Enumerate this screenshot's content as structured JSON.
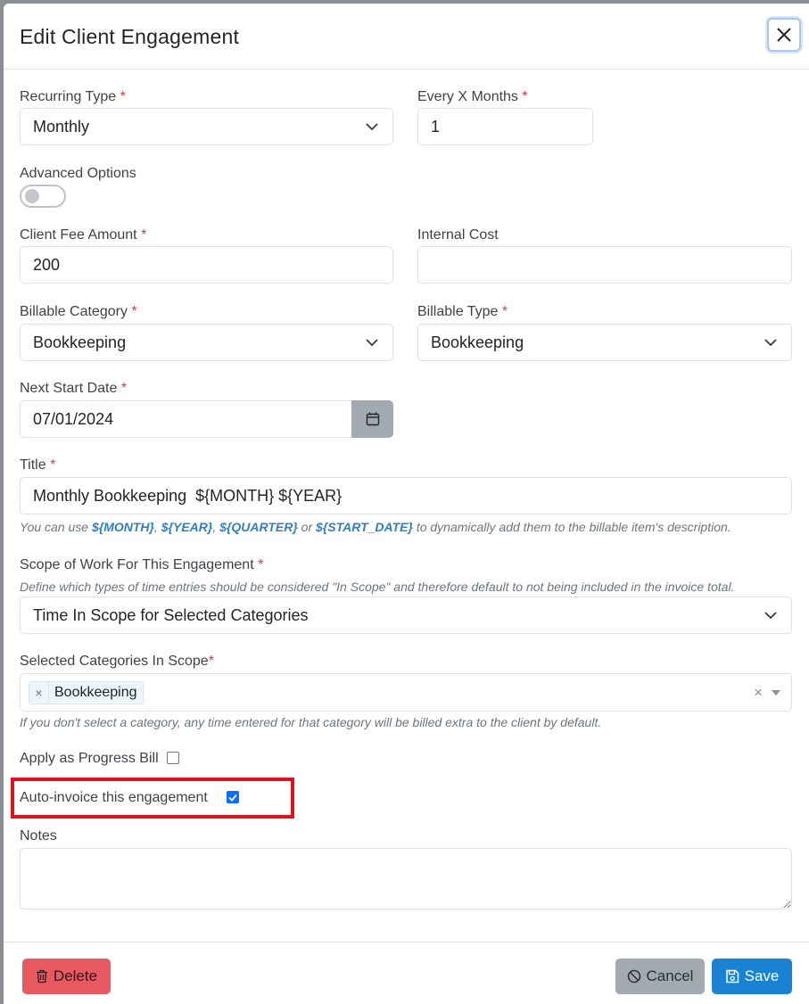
{
  "modal": {
    "title": "Edit Client Engagement",
    "close_icon": "close-icon"
  },
  "fields": {
    "recurring_type": {
      "label": "Recurring Type",
      "required": "*",
      "value": "Monthly"
    },
    "every_x_months": {
      "label": "Every X Months",
      "required": "*",
      "value": "1"
    },
    "advanced_options": {
      "label": "Advanced Options",
      "enabled": false
    },
    "client_fee_amount": {
      "label": "Client Fee Amount",
      "required": "*",
      "value": "200"
    },
    "internal_cost": {
      "label": "Internal Cost",
      "value": ""
    },
    "billable_category": {
      "label": "Billable Category",
      "required": "*",
      "value": "Bookkeeping"
    },
    "billable_type": {
      "label": "Billable Type",
      "required": "*",
      "value": "Bookkeeping"
    },
    "next_start_date": {
      "label": "Next Start Date",
      "required": "*",
      "value": "07/01/2024",
      "icon": "calendar-icon"
    },
    "title": {
      "label": "Title",
      "required": "*",
      "value": "Monthly Bookkeeping  ${MONTH} ${YEAR}",
      "help": {
        "prefix": "You can use",
        "var_month": "${MONTH}",
        "sep1": ",",
        "var_year": "${YEAR}",
        "sep2": ",",
        "var_quarter": "${QUARTER}",
        "or": "or",
        "var_start_date": "${START_DATE}",
        "suffix": "to dynamically add them to the billable item's description."
      }
    },
    "scope_of_work": {
      "label": "Scope of Work For This Engagement",
      "required": "*",
      "help": "Define which types of time entries should be considered \"In Scope\" and therefore default to not being included in the invoice total.",
      "value": "Time In Scope for Selected Categories"
    },
    "selected_categories": {
      "label": "Selected Categories In Scope",
      "required": "*",
      "chips": [
        "Bookkeeping"
      ],
      "chip_remove": "×",
      "clear": "×",
      "help": "If you don't select a category, any time entered for that category will be billed extra to the client by default."
    },
    "progress_bill": {
      "label": "Apply as Progress Bill",
      "checked": false
    },
    "auto_invoice": {
      "label": "Auto-invoice this engagement",
      "checked": true
    },
    "notes": {
      "label": "Notes",
      "value": ""
    }
  },
  "footer": {
    "delete_label": "Delete",
    "cancel_label": "Cancel",
    "save_label": "Save"
  },
  "colors": {
    "required": "#dc3545",
    "highlight": "#e0121b",
    "save": "#1a82d2",
    "delete": "#e85a62",
    "cancel": "#a3a9b0",
    "help_var": "#2f7fc1"
  }
}
